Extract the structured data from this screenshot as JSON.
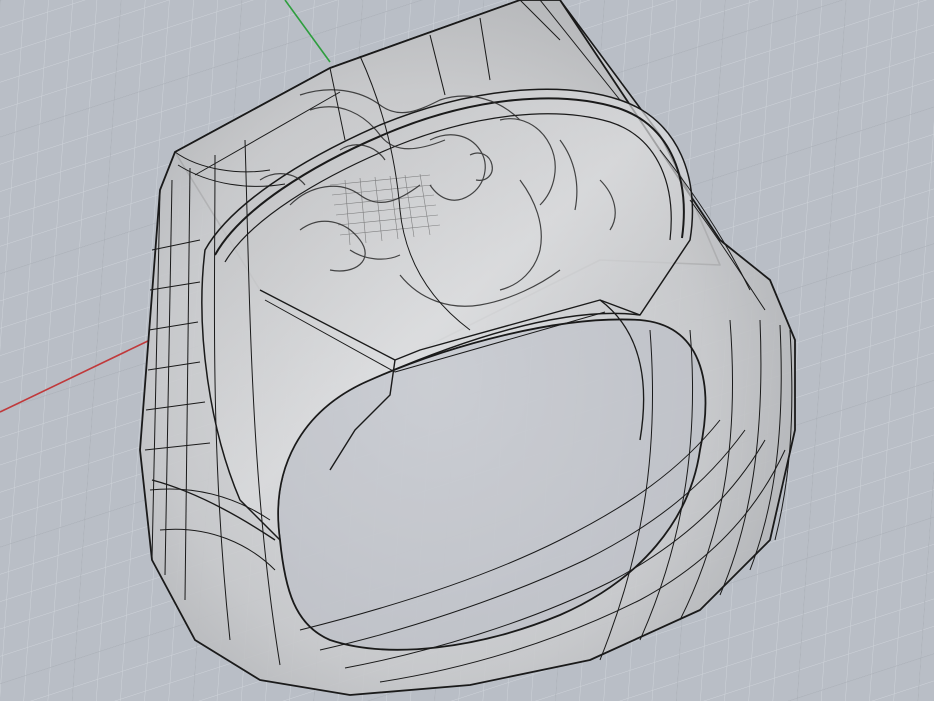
{
  "viewport": {
    "background": "#b9bec6",
    "grid": {
      "visible": true,
      "minor_color": "#cdd2d8",
      "major_color": "#a9aeb6"
    },
    "axes": {
      "x_axis_color": "#c0393b",
      "y_axis_color": "#2e9e3e"
    }
  },
  "model": {
    "object": "signet-ring",
    "display_mode": "ghosted",
    "surface_color": "#c8c9cb",
    "highlight_color": "#e8e9ea",
    "shadow_color": "#9a9c9f",
    "isocurve_color": "#1a1a1a",
    "engraving": "medusa-head-relief"
  }
}
